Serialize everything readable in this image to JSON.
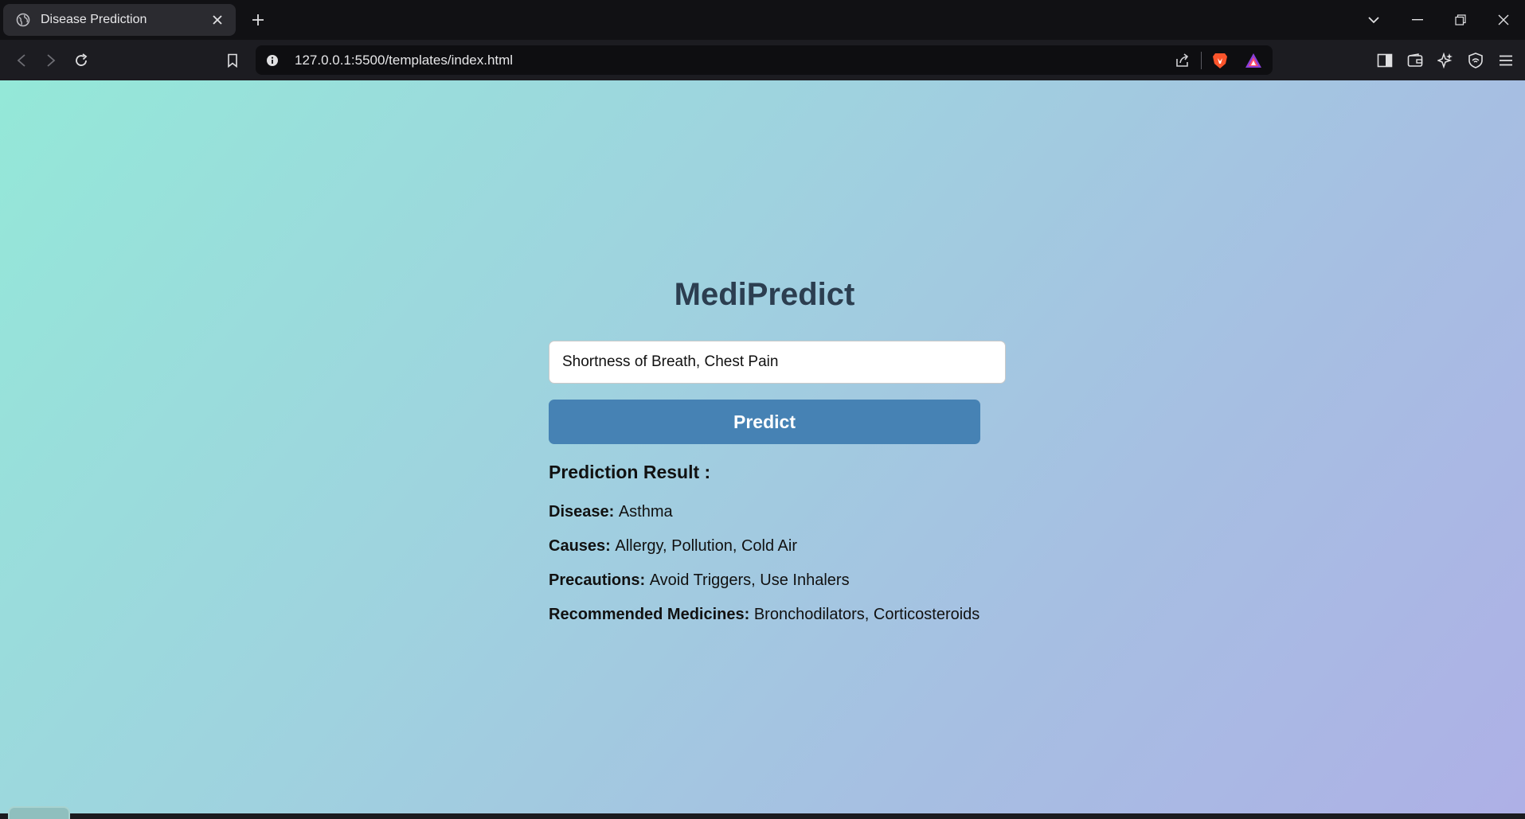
{
  "browser": {
    "tab_title": "Disease Prediction",
    "url": "127.0.0.1:5500/templates/index.html"
  },
  "page": {
    "title": "MediPredict",
    "symptom_input_value": "Shortness of Breath, Chest Pain",
    "predict_label": "Predict",
    "result_heading": "Prediction Result :",
    "results": {
      "disease_label": "Disease:",
      "disease_value": "Asthma",
      "causes_label": "Causes:",
      "causes_value": "Allergy, Pollution, Cold Air",
      "precautions_label": "Precautions:",
      "precautions_value": "Avoid Triggers, Use Inhalers",
      "medicines_label": "Recommended Medicines:",
      "medicines_value": "Bronchodilators, Corticosteroids"
    }
  },
  "colors": {
    "title": "#2c3e50",
    "button": "#4682b4",
    "gradient_start": "#94e8d8",
    "gradient_end": "#aeb0e6"
  }
}
